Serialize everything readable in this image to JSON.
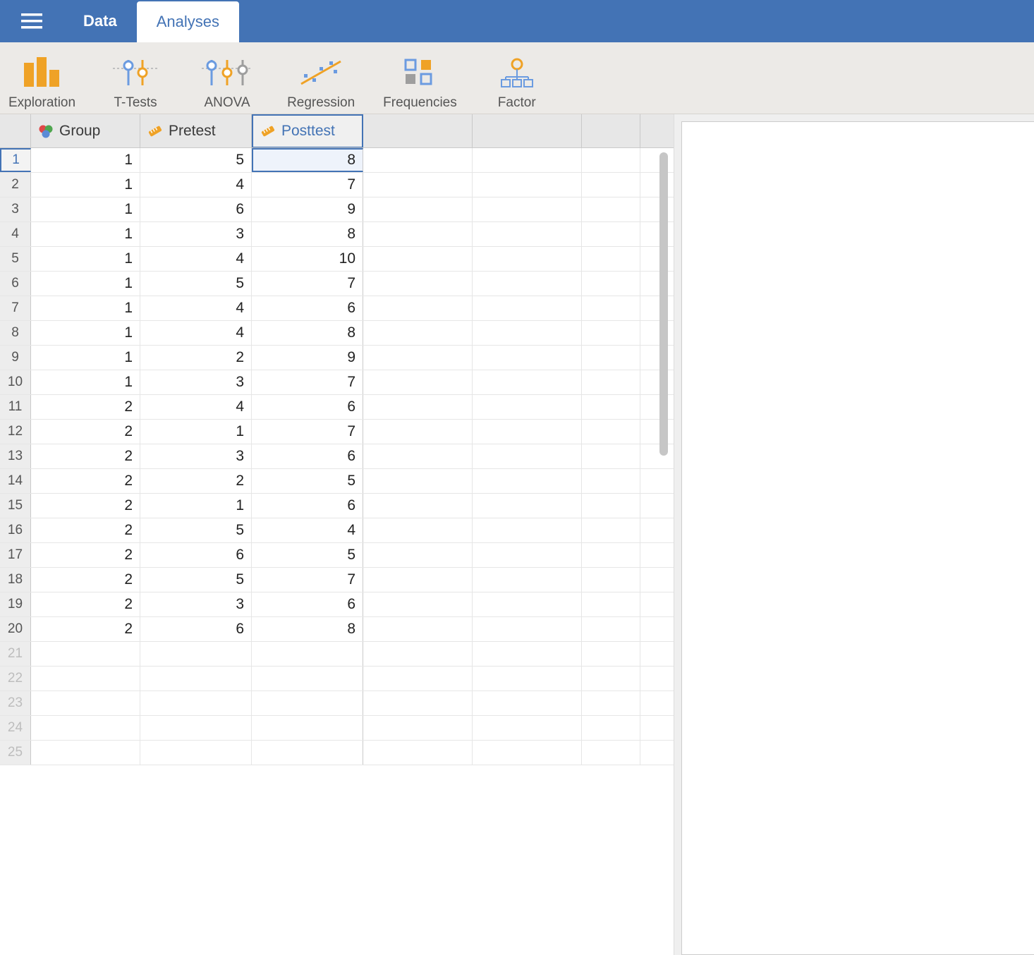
{
  "topbar": {
    "tabs": {
      "data": "Data",
      "analyses": "Analyses"
    },
    "active_tab": "analyses"
  },
  "ribbon": {
    "exploration": "Exploration",
    "ttests": "T-Tests",
    "anova": "ANOVA",
    "regression": "Regression",
    "frequencies": "Frequencies",
    "factor": "Factor"
  },
  "columns": {
    "group": "Group",
    "pretest": "Pretest",
    "posttest": "Posttest",
    "selected": "posttest"
  },
  "rows": [
    {
      "n": 1,
      "group": 1,
      "pretest": 5,
      "posttest": 8
    },
    {
      "n": 2,
      "group": 1,
      "pretest": 4,
      "posttest": 7
    },
    {
      "n": 3,
      "group": 1,
      "pretest": 6,
      "posttest": 9
    },
    {
      "n": 4,
      "group": 1,
      "pretest": 3,
      "posttest": 8
    },
    {
      "n": 5,
      "group": 1,
      "pretest": 4,
      "posttest": 10
    },
    {
      "n": 6,
      "group": 1,
      "pretest": 5,
      "posttest": 7
    },
    {
      "n": 7,
      "group": 1,
      "pretest": 4,
      "posttest": 6
    },
    {
      "n": 8,
      "group": 1,
      "pretest": 4,
      "posttest": 8
    },
    {
      "n": 9,
      "group": 1,
      "pretest": 2,
      "posttest": 9
    },
    {
      "n": 10,
      "group": 1,
      "pretest": 3,
      "posttest": 7
    },
    {
      "n": 11,
      "group": 2,
      "pretest": 4,
      "posttest": 6
    },
    {
      "n": 12,
      "group": 2,
      "pretest": 1,
      "posttest": 7
    },
    {
      "n": 13,
      "group": 2,
      "pretest": 3,
      "posttest": 6
    },
    {
      "n": 14,
      "group": 2,
      "pretest": 2,
      "posttest": 5
    },
    {
      "n": 15,
      "group": 2,
      "pretest": 1,
      "posttest": 6
    },
    {
      "n": 16,
      "group": 2,
      "pretest": 5,
      "posttest": 4
    },
    {
      "n": 17,
      "group": 2,
      "pretest": 6,
      "posttest": 5
    },
    {
      "n": 18,
      "group": 2,
      "pretest": 5,
      "posttest": 7
    },
    {
      "n": 19,
      "group": 2,
      "pretest": 3,
      "posttest": 6
    },
    {
      "n": 20,
      "group": 2,
      "pretest": 6,
      "posttest": 8
    }
  ],
  "empty_row_numbers": [
    21,
    22,
    23,
    24,
    25
  ],
  "selected_cell": {
    "row": 1,
    "col": "posttest"
  },
  "colors": {
    "brand": "#4373b5",
    "accent_orange": "#efa226",
    "accent_blue": "#6b9be0",
    "accent_grey": "#9e9e9e"
  }
}
